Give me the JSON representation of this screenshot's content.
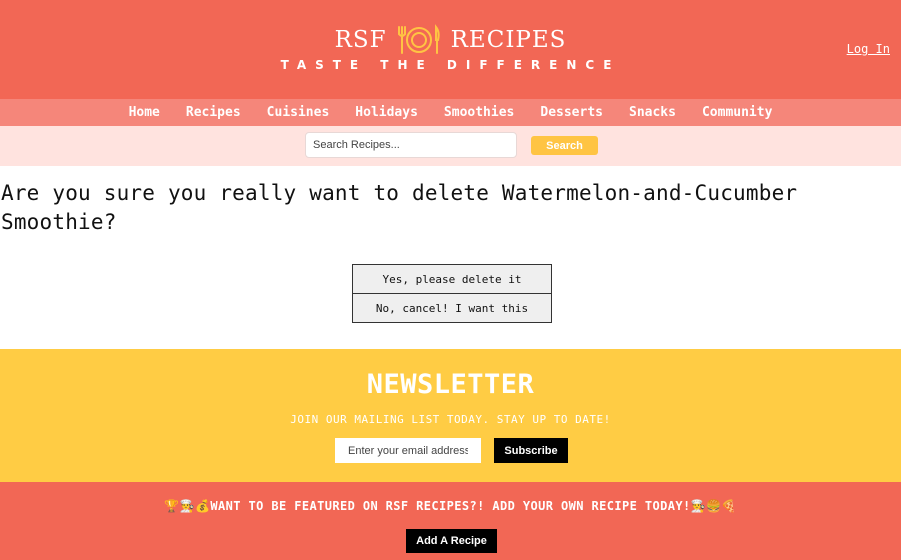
{
  "header": {
    "logo_left": "RSF",
    "logo_right": "RECIPES",
    "tagline": "TASTE THE DIFFERENCE",
    "login_label": "Log In"
  },
  "nav": {
    "items": [
      {
        "label": "Home"
      },
      {
        "label": "Recipes"
      },
      {
        "label": "Cuisines"
      },
      {
        "label": "Holidays"
      },
      {
        "label": "Smoothies"
      },
      {
        "label": "Desserts"
      },
      {
        "label": "Snacks"
      },
      {
        "label": "Community"
      }
    ]
  },
  "search": {
    "placeholder": "Search Recipes...",
    "button_label": "Search"
  },
  "confirm": {
    "question": "Are you sure you really want to delete Watermelon-and-Cucumber Smoothie?",
    "yes_label": "Yes, please delete it",
    "no_label": "No, cancel! I want this"
  },
  "newsletter": {
    "title": "NEWSLETTER",
    "subtitle": "JOIN OUR MAILING LIST TODAY. STAY UP TO DATE!",
    "email_placeholder": "Enter your email address",
    "subscribe_label": "Subscribe"
  },
  "footer": {
    "feature_text": "🏆👨‍🍳💰WANT TO BE FEATURED ON RSF RECIPES?! ADD YOUR OWN RECIPE TODAY!👨‍🍳🍔🍕",
    "add_recipe_label": "Add A Recipe"
  },
  "colors": {
    "header_bg": "#f26755",
    "nav_bg": "#f5867a",
    "search_bg": "#ffe3df",
    "accent_yellow": "#ffcc44",
    "search_button": "#ffc443",
    "logo_icon": "#ffc443"
  },
  "icons": {
    "logo": "fork-plate-knife-icon"
  }
}
